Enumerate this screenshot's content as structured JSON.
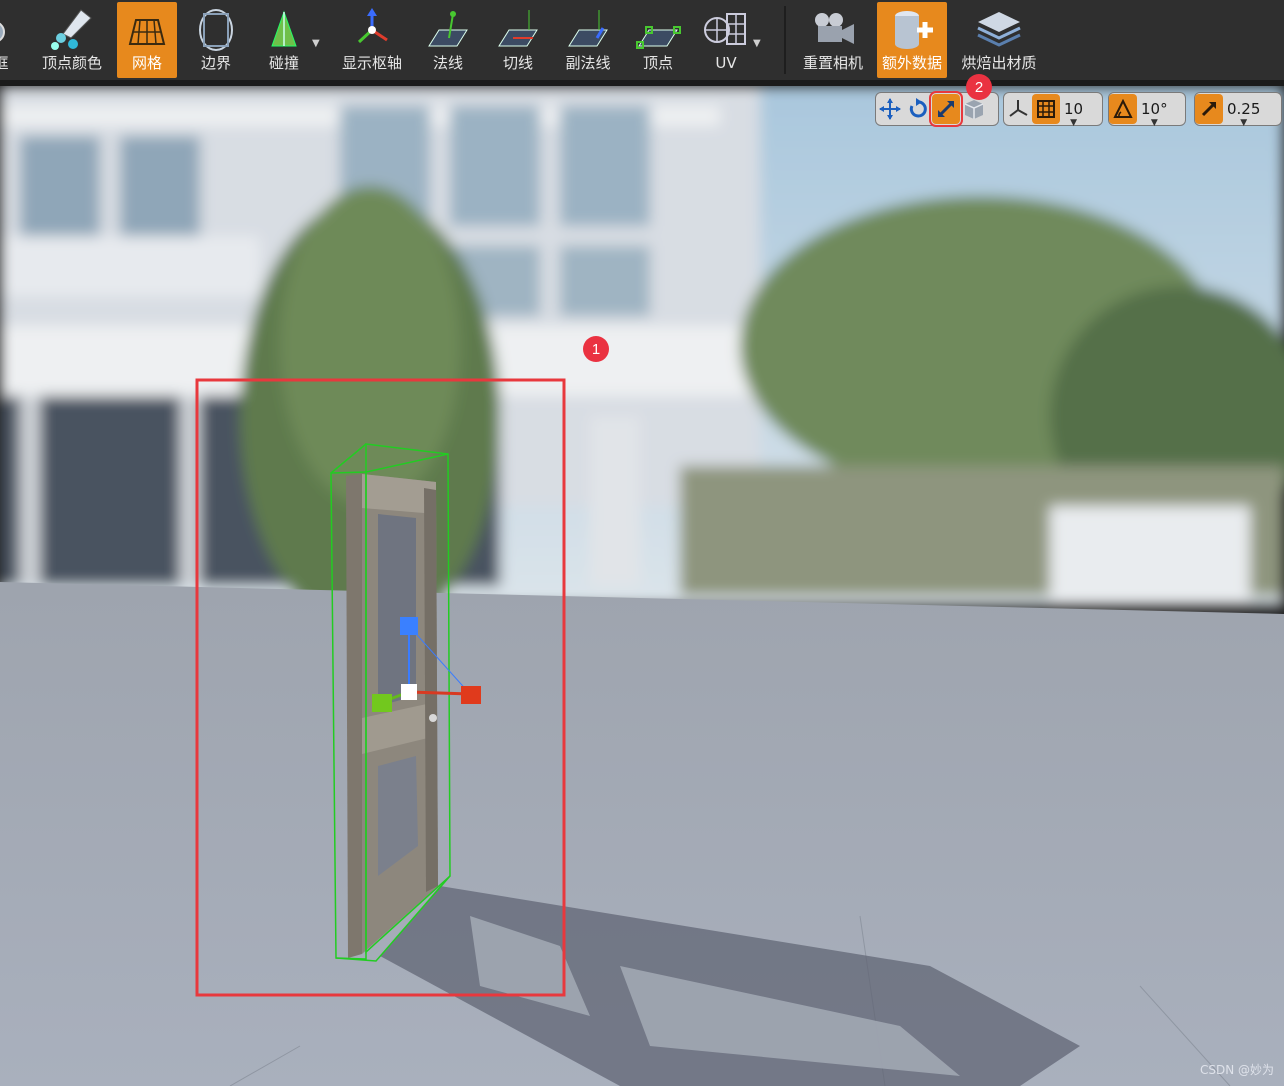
{
  "toolbar": {
    "items": [
      {
        "label": "框",
        "icon": "wireframe-icon"
      },
      {
        "label": "顶点颜色",
        "icon": "vertex-color-icon"
      },
      {
        "label": "网格",
        "icon": "mesh-grid-icon",
        "active": true
      },
      {
        "label": "边界",
        "icon": "bounds-icon"
      },
      {
        "label": "碰撞",
        "icon": "collision-icon",
        "dropdown": true
      },
      {
        "label": "显示枢轴",
        "icon": "pivot-icon"
      },
      {
        "label": "法线",
        "icon": "normals-icon"
      },
      {
        "label": "切线",
        "icon": "tangents-icon"
      },
      {
        "label": "副法线",
        "icon": "binormals-icon"
      },
      {
        "label": "顶点",
        "icon": "vertices-icon"
      },
      {
        "label": "UV",
        "icon": "uv-icon",
        "dropdown": true
      },
      {
        "label": "重置相机",
        "icon": "reset-camera-icon"
      },
      {
        "label": "额外数据",
        "icon": "additional-data-icon",
        "active": true
      },
      {
        "label": "烘焙出材质",
        "icon": "bake-material-icon"
      }
    ]
  },
  "viewport_toolbar": {
    "grid_snap": "10",
    "rotation_snap": "10°",
    "scale_snap": "0.25"
  },
  "markers": {
    "one": "1",
    "two": "2"
  },
  "watermark": "CSDN @妙为",
  "colors": {
    "accent": "#e7891d",
    "highlight_box": "#e8383d",
    "bounds_green": "#22cc22"
  }
}
